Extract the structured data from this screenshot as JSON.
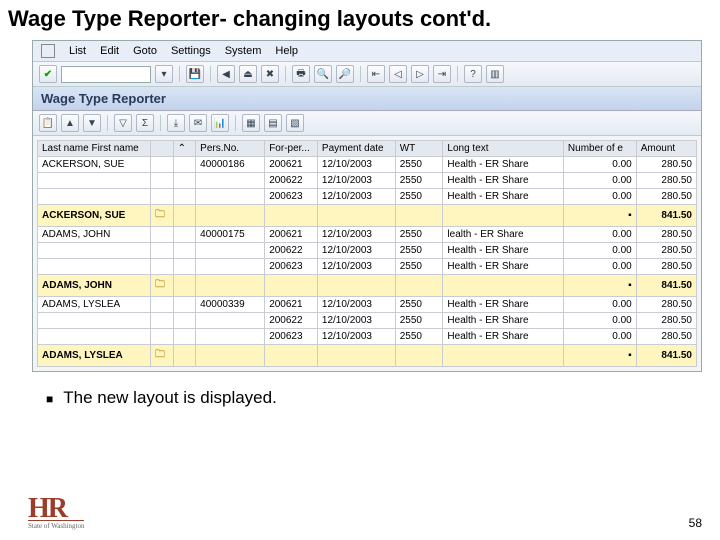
{
  "slide": {
    "title": "Wage Type Reporter- changing layouts cont'd."
  },
  "menubar": {
    "items": [
      "List",
      "Edit",
      "Goto",
      "Settings",
      "System",
      "Help"
    ]
  },
  "app": {
    "title": "Wage Type Reporter"
  },
  "grid": {
    "headers": [
      "Last name First name",
      "",
      "Pers.No.",
      "For-per...",
      "Payment date",
      "WT",
      "Long text",
      "Number of e",
      "Amount"
    ],
    "rows": [
      {
        "name": "ACKERSON, SUE",
        "mark": "",
        "pers": "40000186",
        "fp": "200621",
        "date": "12/10/2003",
        "wt": "2550",
        "long": "Health - ER Share",
        "ne": "0.00",
        "amt": "280.50"
      },
      {
        "name": "",
        "mark": "",
        "pers": "",
        "fp": "200622",
        "date": "12/10/2003",
        "wt": "2550",
        "long": "Health - ER Share",
        "ne": "0.00",
        "amt": "280.50"
      },
      {
        "name": "",
        "mark": "",
        "pers": "",
        "fp": "200623",
        "date": "12/10/2003",
        "wt": "2550",
        "long": "Health - ER Share",
        "ne": "0.00",
        "amt": "280.50"
      },
      {
        "subtotal": true,
        "name": "ACKERSON, SUE",
        "marker": "▪",
        "amt": "841.50"
      },
      {
        "name": "ADAMS, JOHN",
        "mark": "",
        "pers": "40000175",
        "fp": "200621",
        "date": "12/10/2003",
        "wt": "2550",
        "long": "lealth - ER Share",
        "ne": "0.00",
        "amt": "280.50"
      },
      {
        "name": "",
        "mark": "",
        "pers": "",
        "fp": "200622",
        "date": "12/10/2003",
        "wt": "2550",
        "long": "Health - ER Share",
        "ne": "0.00",
        "amt": "280.50"
      },
      {
        "name": "",
        "mark": "",
        "pers": "",
        "fp": "200623",
        "date": "12/10/2003",
        "wt": "2550",
        "long": "Health - ER Share",
        "ne": "0.00",
        "amt": "280.50"
      },
      {
        "subtotal": true,
        "name": "ADAMS, JOHN",
        "marker": "▪",
        "amt": "841.50"
      },
      {
        "name": "ADAMS, LYSLEA",
        "mark": "",
        "pers": "40000339",
        "fp": "200621",
        "date": "12/10/2003",
        "wt": "2550",
        "long": "Health - ER Share",
        "ne": "0.00",
        "amt": "280.50"
      },
      {
        "name": "",
        "mark": "",
        "pers": "",
        "fp": "200622",
        "date": "12/10/2003",
        "wt": "2550",
        "long": "Health - ER Share",
        "ne": "0.00",
        "amt": "280.50"
      },
      {
        "name": "",
        "mark": "",
        "pers": "",
        "fp": "200623",
        "date": "12/10/2003",
        "wt": "2550",
        "long": "Health - ER Share",
        "ne": "0.00",
        "amt": "280.50"
      },
      {
        "subtotal": true,
        "name": "ADAMS, LYSLEA",
        "marker": "▪",
        "amt": "841.50"
      }
    ]
  },
  "note": "The new layout is displayed.",
  "footer": {
    "logo_main": "HR",
    "logo_sub": "State of Washington",
    "page": "58"
  }
}
